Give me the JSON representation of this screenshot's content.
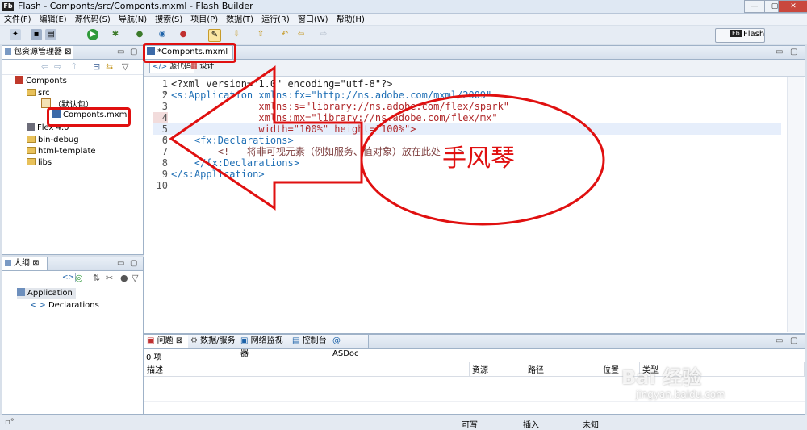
{
  "window": {
    "app_icon": "Fb",
    "title": "Flash  -  Componts/src/Componts.mxml  -  Flash Builder",
    "minimize": "—",
    "maximize": "▢",
    "close": "✕"
  },
  "menu": [
    "文件(F)",
    "编辑(E)",
    "源代码(S)",
    "导航(N)",
    "搜索(S)",
    "项目(P)",
    "数据(T)",
    "运行(R)",
    "窗口(W)",
    "帮助(H)"
  ],
  "perspective": {
    "icon": "Fb",
    "label": "Flash"
  },
  "package_explorer": {
    "tab_label": "包资源管理器",
    "tree": [
      {
        "label": "Componts",
        "icon": "project-icon"
      },
      {
        "label": "src",
        "icon": "source-folder-icon"
      },
      {
        "label": "（默认包）",
        "icon": "package-icon"
      },
      {
        "label": "Componts.mxml",
        "icon": "mxml-file-icon"
      },
      {
        "label": "Flex 4.0",
        "icon": "library-icon"
      },
      {
        "label": "bin-debug",
        "icon": "folder-icon"
      },
      {
        "label": "html-template",
        "icon": "folder-icon"
      },
      {
        "label": "libs",
        "icon": "folder-icon"
      }
    ]
  },
  "outline": {
    "tab_label": "大纲",
    "items": [
      {
        "label": "Application"
      },
      {
        "label": "Declarations"
      }
    ]
  },
  "editor": {
    "tab_label": "*Componts.mxml",
    "mode_source": "源代码",
    "mode_design": "设计",
    "line_numbers": [
      "1",
      "2",
      "3",
      "4",
      "5",
      "6",
      "7",
      "8",
      "9",
      "10"
    ],
    "lines": [
      "<?xml version=\"1.0\" encoding=\"utf-8\"?>",
      "<s:Application xmlns:fx=\"http://ns.adobe.com/mxml/2009\"",
      "               xmlns:s=\"library://ns.adobe.com/flex/spark\"",
      "               xmlns:mx=\"library://ns.adobe.com/flex/mx\"",
      "               width=\"100%\" height=\"100%\">",
      "    <fx:Declarations>",
      "        <!-- 将非可视元素（例如服务、值对象）放在此处 -->",
      "    </fx:Declarations>",
      "</s:Application>",
      ""
    ],
    "active_line": 5
  },
  "annotation_text": "手风琴",
  "bottom_panel": {
    "tabs": [
      "问题",
      "数据/服务",
      "网络监视器",
      "控制台",
      "ASDoc"
    ],
    "count": "0 项",
    "columns": [
      "描述",
      "资源",
      "路径",
      "位置",
      "类型"
    ]
  },
  "status": {
    "writable": "可写",
    "insert": "插入",
    "unknown": "未知"
  },
  "watermark": {
    "brand": "Bai 经验",
    "url": "jingyan.baidu.com"
  },
  "colors": {
    "annotation_red": "#e01010",
    "tag_blue": "#1f6fb5",
    "string_red": "#b0282a"
  }
}
